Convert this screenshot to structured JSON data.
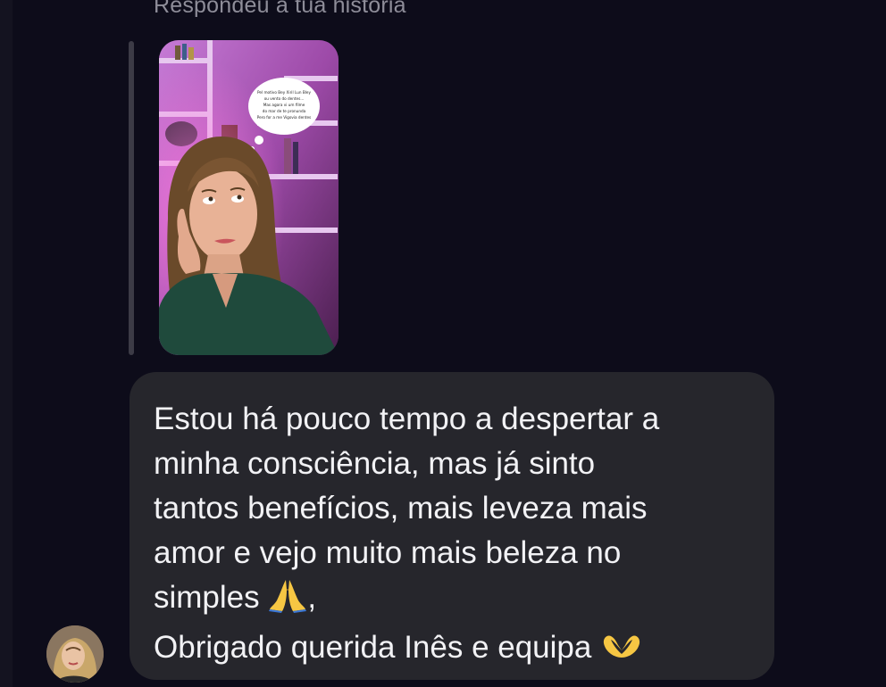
{
  "reply": {
    "label": "Respondeu à tua história"
  },
  "story": {
    "thought_text": [
      "Pel motivo Bey Xiril Lun Bley",
      "ou vento do dentes...",
      "Mas agora vi um filme",
      "do mar de te pronunda",
      "Pero for a me Vigovia dentes"
    ]
  },
  "message": {
    "lines": [
      "Estou há pouco tempo a despertar a",
      "minha consciência, mas já sinto",
      "tantos benefícios, mais leveza mais",
      "amor e vejo muito mais beleza no",
      "simples",
      "Obrigado querida Inês e equipa"
    ],
    "line5_suffix": ","
  },
  "icons": {
    "praying_hands": "praying-hands-emoji",
    "heart_hands": "heart-hands-emoji"
  },
  "colors": {
    "background": "#0d0c1a",
    "bubble": "#26262c",
    "muted_text": "#8e8d99",
    "message_text": "#f2f2f5"
  }
}
